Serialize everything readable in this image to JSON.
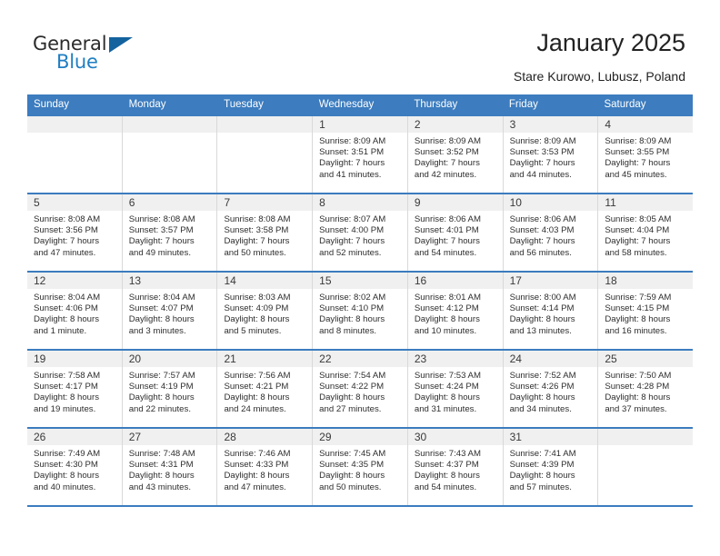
{
  "brand": {
    "name_part1": "General",
    "name_part2": "Blue",
    "triangle_color": "#14639f",
    "blue_color": "#1f7ec2"
  },
  "header": {
    "title": "January 2025",
    "subtitle": "Stare Kurowo, Lubusz, Poland"
  },
  "theme": {
    "header_band": "#3c7cbf",
    "daynum_band": "#f0f0f0",
    "cell_border": "#d9d9d9"
  },
  "weekdays": [
    "Sunday",
    "Monday",
    "Tuesday",
    "Wednesday",
    "Thursday",
    "Friday",
    "Saturday"
  ],
  "weeks": [
    [
      {
        "day": "",
        "empty": true
      },
      {
        "day": "",
        "empty": true
      },
      {
        "day": "",
        "empty": true
      },
      {
        "day": "1",
        "sunrise": "Sunrise: 8:09 AM",
        "sunset": "Sunset: 3:51 PM",
        "daylight1": "Daylight: 7 hours",
        "daylight2": "and 41 minutes."
      },
      {
        "day": "2",
        "sunrise": "Sunrise: 8:09 AM",
        "sunset": "Sunset: 3:52 PM",
        "daylight1": "Daylight: 7 hours",
        "daylight2": "and 42 minutes."
      },
      {
        "day": "3",
        "sunrise": "Sunrise: 8:09 AM",
        "sunset": "Sunset: 3:53 PM",
        "daylight1": "Daylight: 7 hours",
        "daylight2": "and 44 minutes."
      },
      {
        "day": "4",
        "sunrise": "Sunrise: 8:09 AM",
        "sunset": "Sunset: 3:55 PM",
        "daylight1": "Daylight: 7 hours",
        "daylight2": "and 45 minutes."
      }
    ],
    [
      {
        "day": "5",
        "sunrise": "Sunrise: 8:08 AM",
        "sunset": "Sunset: 3:56 PM",
        "daylight1": "Daylight: 7 hours",
        "daylight2": "and 47 minutes."
      },
      {
        "day": "6",
        "sunrise": "Sunrise: 8:08 AM",
        "sunset": "Sunset: 3:57 PM",
        "daylight1": "Daylight: 7 hours",
        "daylight2": "and 49 minutes."
      },
      {
        "day": "7",
        "sunrise": "Sunrise: 8:08 AM",
        "sunset": "Sunset: 3:58 PM",
        "daylight1": "Daylight: 7 hours",
        "daylight2": "and 50 minutes."
      },
      {
        "day": "8",
        "sunrise": "Sunrise: 8:07 AM",
        "sunset": "Sunset: 4:00 PM",
        "daylight1": "Daylight: 7 hours",
        "daylight2": "and 52 minutes."
      },
      {
        "day": "9",
        "sunrise": "Sunrise: 8:06 AM",
        "sunset": "Sunset: 4:01 PM",
        "daylight1": "Daylight: 7 hours",
        "daylight2": "and 54 minutes."
      },
      {
        "day": "10",
        "sunrise": "Sunrise: 8:06 AM",
        "sunset": "Sunset: 4:03 PM",
        "daylight1": "Daylight: 7 hours",
        "daylight2": "and 56 minutes."
      },
      {
        "day": "11",
        "sunrise": "Sunrise: 8:05 AM",
        "sunset": "Sunset: 4:04 PM",
        "daylight1": "Daylight: 7 hours",
        "daylight2": "and 58 minutes."
      }
    ],
    [
      {
        "day": "12",
        "sunrise": "Sunrise: 8:04 AM",
        "sunset": "Sunset: 4:06 PM",
        "daylight1": "Daylight: 8 hours",
        "daylight2": "and 1 minute."
      },
      {
        "day": "13",
        "sunrise": "Sunrise: 8:04 AM",
        "sunset": "Sunset: 4:07 PM",
        "daylight1": "Daylight: 8 hours",
        "daylight2": "and 3 minutes."
      },
      {
        "day": "14",
        "sunrise": "Sunrise: 8:03 AM",
        "sunset": "Sunset: 4:09 PM",
        "daylight1": "Daylight: 8 hours",
        "daylight2": "and 5 minutes."
      },
      {
        "day": "15",
        "sunrise": "Sunrise: 8:02 AM",
        "sunset": "Sunset: 4:10 PM",
        "daylight1": "Daylight: 8 hours",
        "daylight2": "and 8 minutes."
      },
      {
        "day": "16",
        "sunrise": "Sunrise: 8:01 AM",
        "sunset": "Sunset: 4:12 PM",
        "daylight1": "Daylight: 8 hours",
        "daylight2": "and 10 minutes."
      },
      {
        "day": "17",
        "sunrise": "Sunrise: 8:00 AM",
        "sunset": "Sunset: 4:14 PM",
        "daylight1": "Daylight: 8 hours",
        "daylight2": "and 13 minutes."
      },
      {
        "day": "18",
        "sunrise": "Sunrise: 7:59 AM",
        "sunset": "Sunset: 4:15 PM",
        "daylight1": "Daylight: 8 hours",
        "daylight2": "and 16 minutes."
      }
    ],
    [
      {
        "day": "19",
        "sunrise": "Sunrise: 7:58 AM",
        "sunset": "Sunset: 4:17 PM",
        "daylight1": "Daylight: 8 hours",
        "daylight2": "and 19 minutes."
      },
      {
        "day": "20",
        "sunrise": "Sunrise: 7:57 AM",
        "sunset": "Sunset: 4:19 PM",
        "daylight1": "Daylight: 8 hours",
        "daylight2": "and 22 minutes."
      },
      {
        "day": "21",
        "sunrise": "Sunrise: 7:56 AM",
        "sunset": "Sunset: 4:21 PM",
        "daylight1": "Daylight: 8 hours",
        "daylight2": "and 24 minutes."
      },
      {
        "day": "22",
        "sunrise": "Sunrise: 7:54 AM",
        "sunset": "Sunset: 4:22 PM",
        "daylight1": "Daylight: 8 hours",
        "daylight2": "and 27 minutes."
      },
      {
        "day": "23",
        "sunrise": "Sunrise: 7:53 AM",
        "sunset": "Sunset: 4:24 PM",
        "daylight1": "Daylight: 8 hours",
        "daylight2": "and 31 minutes."
      },
      {
        "day": "24",
        "sunrise": "Sunrise: 7:52 AM",
        "sunset": "Sunset: 4:26 PM",
        "daylight1": "Daylight: 8 hours",
        "daylight2": "and 34 minutes."
      },
      {
        "day": "25",
        "sunrise": "Sunrise: 7:50 AM",
        "sunset": "Sunset: 4:28 PM",
        "daylight1": "Daylight: 8 hours",
        "daylight2": "and 37 minutes."
      }
    ],
    [
      {
        "day": "26",
        "sunrise": "Sunrise: 7:49 AM",
        "sunset": "Sunset: 4:30 PM",
        "daylight1": "Daylight: 8 hours",
        "daylight2": "and 40 minutes."
      },
      {
        "day": "27",
        "sunrise": "Sunrise: 7:48 AM",
        "sunset": "Sunset: 4:31 PM",
        "daylight1": "Daylight: 8 hours",
        "daylight2": "and 43 minutes."
      },
      {
        "day": "28",
        "sunrise": "Sunrise: 7:46 AM",
        "sunset": "Sunset: 4:33 PM",
        "daylight1": "Daylight: 8 hours",
        "daylight2": "and 47 minutes."
      },
      {
        "day": "29",
        "sunrise": "Sunrise: 7:45 AM",
        "sunset": "Sunset: 4:35 PM",
        "daylight1": "Daylight: 8 hours",
        "daylight2": "and 50 minutes."
      },
      {
        "day": "30",
        "sunrise": "Sunrise: 7:43 AM",
        "sunset": "Sunset: 4:37 PM",
        "daylight1": "Daylight: 8 hours",
        "daylight2": "and 54 minutes."
      },
      {
        "day": "31",
        "sunrise": "Sunrise: 7:41 AM",
        "sunset": "Sunset: 4:39 PM",
        "daylight1": "Daylight: 8 hours",
        "daylight2": "and 57 minutes."
      },
      {
        "day": "",
        "empty": true
      }
    ]
  ]
}
